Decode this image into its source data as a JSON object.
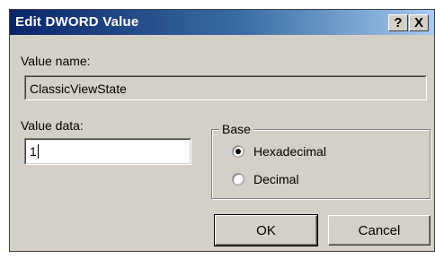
{
  "window": {
    "title": "Edit DWORD Value",
    "help_label": "?",
    "close_label": "X"
  },
  "value_name": {
    "label": "Value name:",
    "value": "ClassicViewState"
  },
  "value_data": {
    "label": "Value data:",
    "value": "1"
  },
  "base": {
    "legend": "Base",
    "options": [
      {
        "label": "Hexadecimal",
        "selected": true
      },
      {
        "label": "Decimal",
        "selected": false
      }
    ]
  },
  "buttons": {
    "ok": "OK",
    "cancel": "Cancel"
  },
  "colors": {
    "title_bar_start": "#0a246a",
    "title_bar_end": "#a6caf0",
    "dialog_face": "#d4d0c8"
  }
}
